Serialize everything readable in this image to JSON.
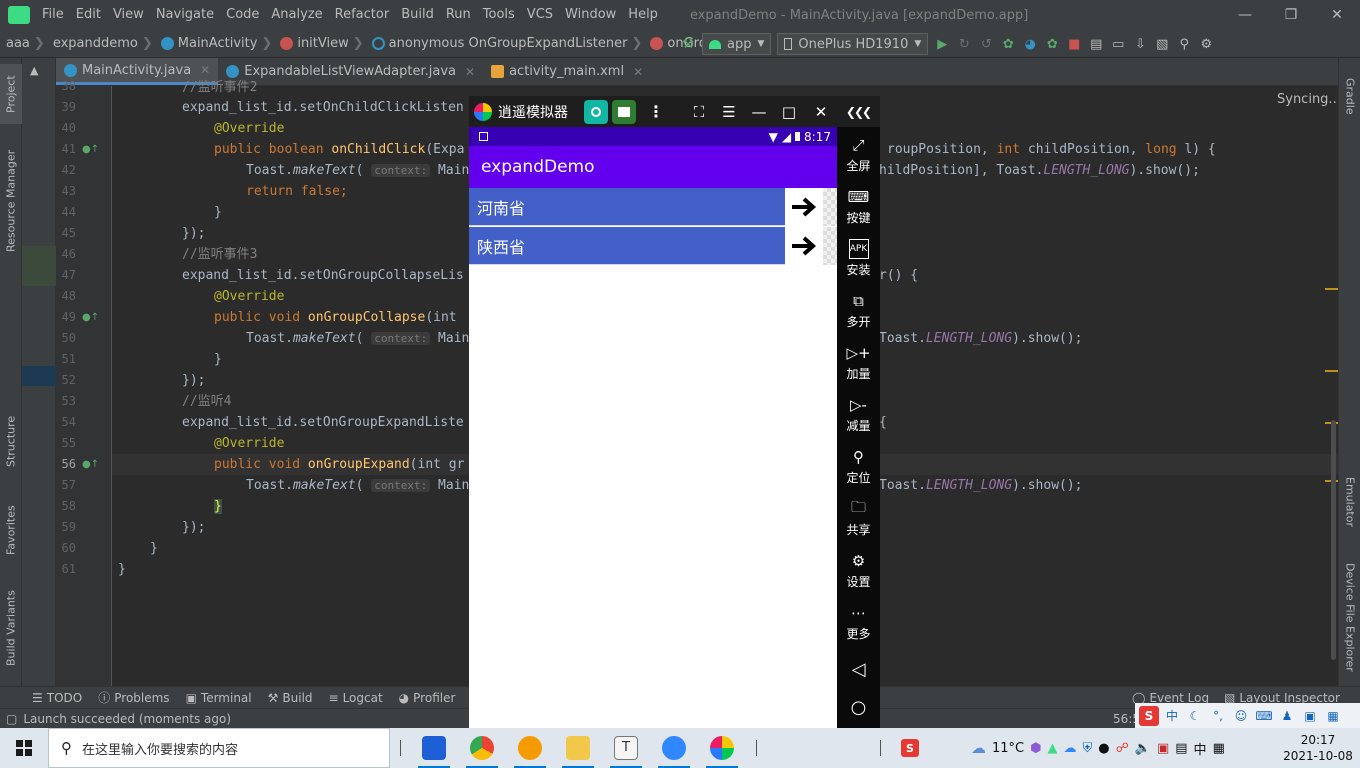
{
  "ide": {
    "menu": [
      "File",
      "Edit",
      "View",
      "Navigate",
      "Code",
      "Analyze",
      "Refactor",
      "Build",
      "Run",
      "Tools",
      "VCS",
      "Window",
      "Help"
    ],
    "window_title": "expandDemo - MainActivity.java [expandDemo.app]",
    "breadcrumbs": [
      "aaa",
      "expanddemo",
      "MainActivity",
      "initView",
      "anonymous OnGroupExpandListener",
      "onGroupExpand"
    ],
    "run_config": "app",
    "device": "OnePlus HD1910",
    "tabs": [
      {
        "label": "MainActivity.java",
        "active": true
      },
      {
        "label": "ExpandableListViewAdapter.java",
        "active": false
      },
      {
        "label": "activity_main.xml",
        "active": false
      }
    ],
    "syncing": "Syncing...",
    "left_tools": [
      "Project",
      "Resource Manager",
      "Structure",
      "Favorites",
      "Build Variants"
    ],
    "right_tools": [
      "Gradle",
      "Emulator",
      "Device File Explorer"
    ],
    "bottom_tools": [
      "TODO",
      "Problems",
      "Terminal",
      "Build",
      "Logcat",
      "Profiler",
      "Event Log",
      "Layout Inspector"
    ],
    "status": "Launch succeeded (moments ago)",
    "position": "56:5"
  },
  "code": {
    "line_numbers": [
      "38",
      "39",
      "40",
      "41",
      "42",
      "43",
      "44",
      "45",
      "46",
      "47",
      "48",
      "49",
      "50",
      "51",
      "52",
      "53",
      "54",
      "55",
      "56",
      "57",
      "58",
      "59",
      "60",
      "61"
    ],
    "l38": "//监听事件2",
    "l39a": "expand_list_id.setOnChildClickListen",
    "l39b": "",
    "l40": "@Override",
    "l41a": "public boolean ",
    "l41b": "onChildClick",
    "l41c": "(Expa",
    "l41r1": "roupPosition, ",
    "l41r2": "int ",
    "l41r3": "childPosition, ",
    "l41r4": "long ",
    "l41r5": "l) {",
    "l42a": "Toast.",
    "l42b": "makeText",
    "l42c": "( ",
    "hint_context": "context:",
    "l42d": " MainAc",
    "l42r1": "hildPosition], Toast.",
    "l42r2": "LENGTH_LONG",
    "l42r3": ").show();",
    "l43a": "return false",
    "l43b": ";",
    "l44": "}",
    "l45": "});",
    "l46": "//监听事件3",
    "l47a": "expand_list_id.setOnGroupCollapseLis",
    "l47r": "r() {",
    "l48": "@Override",
    "l49a": "public void ",
    "l49b": "onGroupCollapse",
    "l49c": "(int",
    "l50a": "Toast.",
    "l50b": "makeText",
    "l50c": "( ",
    "l50d": " MainAc",
    "l50r1": "Toast.",
    "l50r2": "LENGTH_LONG",
    "l50r3": ").show();",
    "l51": "}",
    "l52": "});",
    "l53": "//监听4",
    "l54a": "expand_list_id.setOnGroupExpandListe",
    "l54r": "{",
    "l55": "@Override",
    "l56a": "public void ",
    "l56b": "onGroupExpand",
    "l56c": "(int gr",
    "l57a": "Toast.",
    "l57b": "makeText",
    "l57c": "( ",
    "l57d": " MainAc",
    "l57r1": "Toast.",
    "l57r2": "LENGTH_LONG",
    "l57r3": ").show();",
    "l58": "}",
    "l59": "});",
    "l60": "}",
    "l61": "}"
  },
  "emulator": {
    "title": "逍遥模拟器",
    "status_time": "8:17",
    "app_title": "expandDemo",
    "groups": [
      "河南省",
      "陕西省"
    ],
    "side_buttons": [
      "全屏",
      "按键",
      "安装",
      "多开",
      "加量",
      "减量",
      "定位",
      "共享",
      "设置",
      "更多"
    ]
  },
  "taskbar": {
    "search_placeholder": "在这里输入你要搜索的内容",
    "weather": "11°C",
    "time": "20:17",
    "date": "2021-10-08",
    "ime_label": "中"
  }
}
